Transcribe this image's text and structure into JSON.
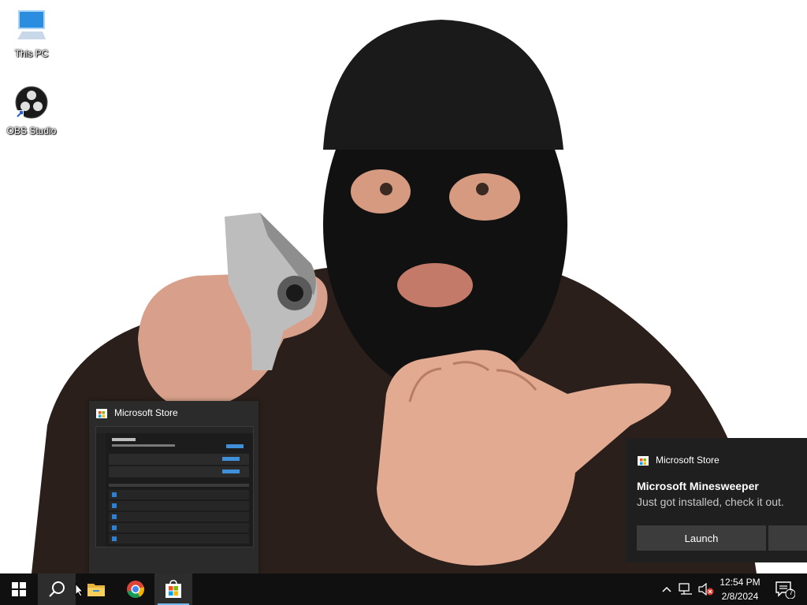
{
  "desktop": {
    "icons": [
      {
        "label": "This PC",
        "icon": "computer-icon"
      },
      {
        "label": "OBS Studio",
        "icon": "obs-icon"
      }
    ]
  },
  "preview": {
    "title": "Microsoft Store",
    "icon": "store-icon"
  },
  "toast": {
    "app": "Microsoft Store",
    "title": "Microsoft Minesweeper",
    "body": "Just got installed, check it out.",
    "primary_button": "Launch"
  },
  "taskbar": {
    "items": [
      "start-icon",
      "search-icon",
      "file-explorer-icon",
      "chrome-icon",
      "store-icon"
    ],
    "active_item": "store-icon",
    "indicator_color": "#76b9ed"
  },
  "tray": {
    "time": "12:54 PM",
    "date": "2/8/2024",
    "notification_count": "7"
  }
}
